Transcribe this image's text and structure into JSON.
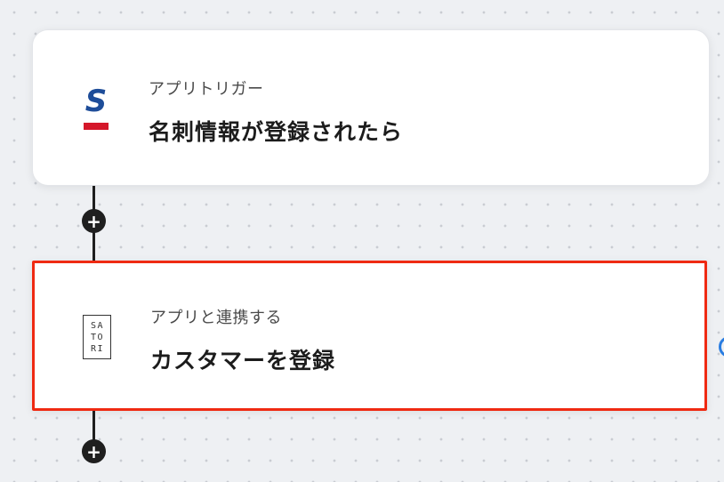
{
  "steps": [
    {
      "id": "trigger",
      "app": "Sansan",
      "label": "アプリトリガー",
      "title": "名刺情報が登録されたら",
      "icon": "sansan-logo-icon"
    },
    {
      "id": "action",
      "app": "SATORI",
      "label": "アプリと連携する",
      "title": "カスタマーを登録",
      "icon": "satori-logo-icon",
      "selected": true
    }
  ],
  "logos": {
    "sansan_letter": "S",
    "satori_lines": [
      "SA",
      "TO",
      "RI"
    ]
  },
  "add_step_symbol": "+",
  "colors": {
    "selected_border": "#ef2a12",
    "connector": "#1f1f1f",
    "sansan_blue": "#1e4d99",
    "sansan_red": "#d5172a",
    "canvas_bg": "#eef0f3"
  }
}
